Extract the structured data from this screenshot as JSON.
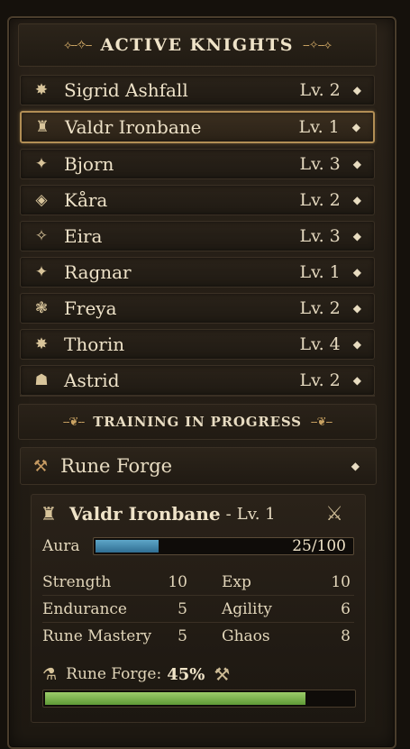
{
  "header": {
    "title": "ACTIVE KNIGHTS"
  },
  "knights": [
    {
      "icon": "✸",
      "icon_name": "sun-emblem-icon",
      "name": "Sigrid Ashfall",
      "level": "Lv. 2",
      "selected": false
    },
    {
      "icon": "♜",
      "icon_name": "rune-emblem-icon",
      "name": "Valdr Ironbane",
      "level": "Lv. 1",
      "selected": true
    },
    {
      "icon": "✦",
      "icon_name": "crossed-axes-icon",
      "name": "Bjorn",
      "level": "Lv. 3",
      "selected": false
    },
    {
      "icon": "◈",
      "icon_name": "diamond-emblem-icon",
      "name": "Kåra",
      "level": "Lv. 2",
      "selected": false
    },
    {
      "icon": "✧",
      "icon_name": "star-diamond-icon",
      "name": "Eira",
      "level": "Lv. 3",
      "selected": false
    },
    {
      "icon": "✦",
      "icon_name": "crossed-axes-icon",
      "name": "Ragnar",
      "level": "Lv. 1",
      "selected": false
    },
    {
      "icon": "❃",
      "icon_name": "flower-emblem-icon",
      "name": "Freya",
      "level": "Lv. 2",
      "selected": false
    },
    {
      "icon": "✸",
      "icon_name": "sun-emblem-icon",
      "name": "Thorin",
      "level": "Lv. 4",
      "selected": false
    },
    {
      "icon": "☗",
      "icon_name": "helm-emblem-icon",
      "name": "Astrid",
      "level": "Lv. 2",
      "selected": false
    }
  ],
  "training": {
    "title": "TRAINING IN PROGRESS",
    "station": "Rune Forge",
    "knight": {
      "name": "Valdr Ironbane",
      "separator": "-",
      "level": "Lv. 1",
      "aura_label": "Aura",
      "aura_value": "25/100",
      "aura_fraction": 0.25,
      "stats": [
        {
          "left_label": "Strength",
          "left_value": "10",
          "right_label": "Exp",
          "right_value": "10"
        },
        {
          "left_label": "Endurance",
          "left_value": "5",
          "right_label": "Agility",
          "right_value": "6"
        },
        {
          "left_label": "Rune Mastery",
          "left_value": "5",
          "right_label": "Ghaos",
          "right_value": "8"
        }
      ],
      "progress_label": "Rune Forge:",
      "progress_text": "45%",
      "progress_fraction": 0.84
    }
  },
  "colors": {
    "accent": "#b28e55",
    "aura": "#3f88ae",
    "progress": "#7fb24d"
  }
}
